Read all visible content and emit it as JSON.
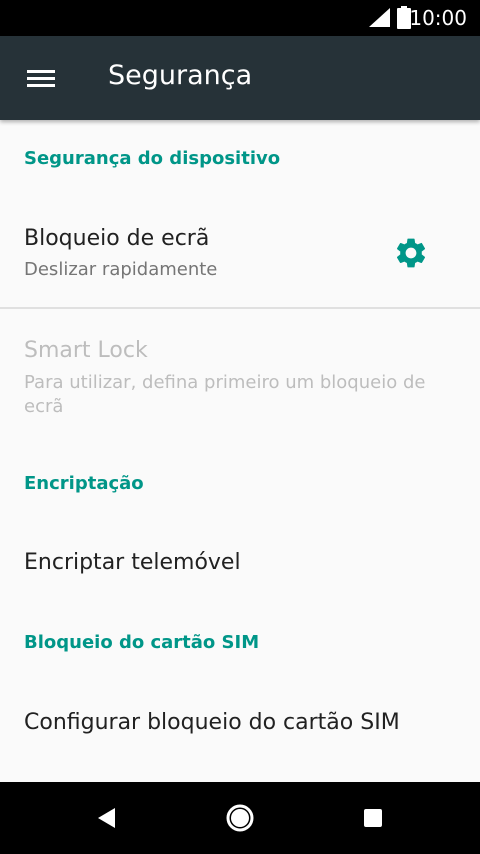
{
  "status_bar": {
    "time": "10:00"
  },
  "toolbar": {
    "title": "Segurança"
  },
  "sections": {
    "device": "Segurança do dispositivo",
    "encryption": "Encriptação",
    "sim": "Bloqueio do cartão SIM"
  },
  "items": {
    "screen_lock": {
      "title": "Bloqueio de ecrã",
      "subtitle": "Deslizar rapidamente"
    },
    "smart_lock": {
      "title": "Smart Lock",
      "subtitle_line1": "Para utilizar, defina primeiro um bloqueio de",
      "subtitle_line2": "ecrã"
    },
    "encrypt_phone": {
      "title": "Encriptar telemóvel"
    },
    "sim_lock": {
      "title": "Configurar bloqueio do cartão SIM"
    }
  },
  "icons": {
    "menu": "menu-icon",
    "settings": "gear-icon",
    "back": "back-icon",
    "home": "home-icon",
    "recents": "recents-icon"
  },
  "colors": {
    "accent": "#009688",
    "toolbar": "#263238"
  }
}
